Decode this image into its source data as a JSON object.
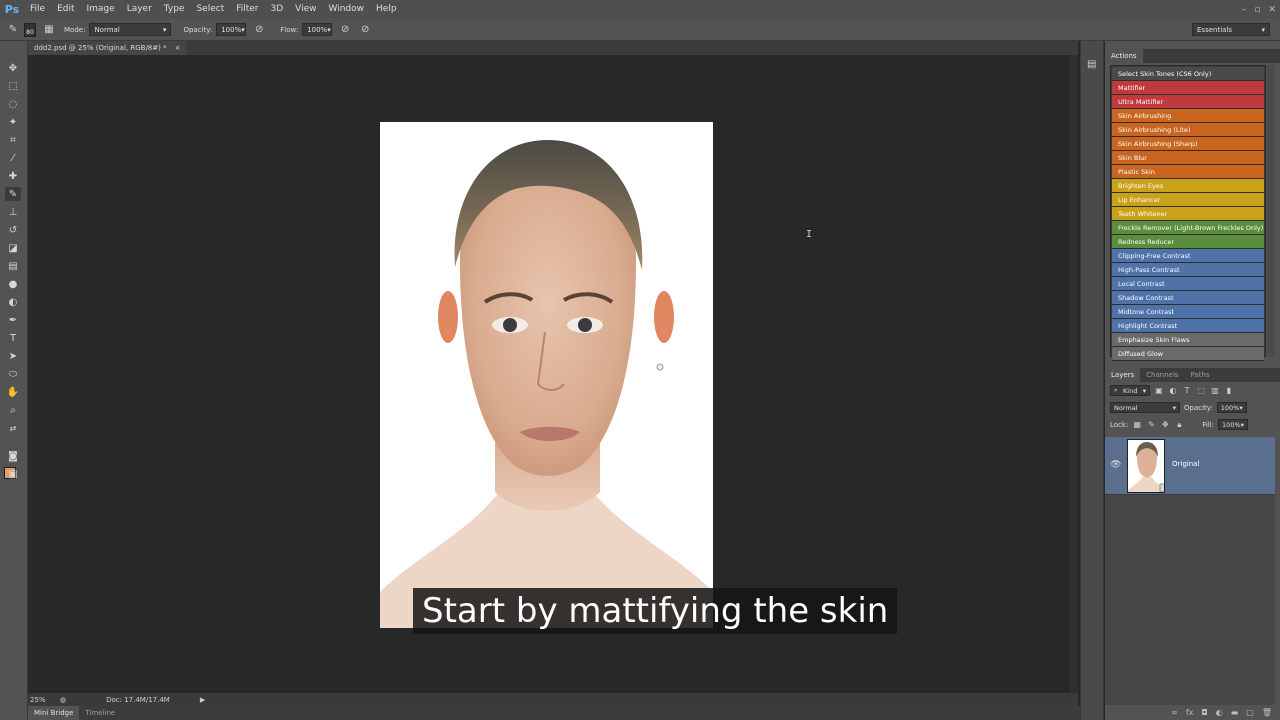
{
  "app": {
    "logo": "Ps"
  },
  "menu": [
    "File",
    "Edit",
    "Image",
    "Layer",
    "Type",
    "Select",
    "Filter",
    "3D",
    "View",
    "Window",
    "Help"
  ],
  "window_controls": [
    "–",
    "▫",
    "✕"
  ],
  "options": {
    "brush_size": "80",
    "mode_label": "Mode:",
    "mode_value": "Normal",
    "opacity_label": "Opacity:",
    "opacity_value": "100%",
    "flow_label": "Flow:",
    "flow_value": "100%",
    "workspace": "Essentials"
  },
  "document": {
    "tab_title": "ddd2.psd @ 25% (Original, RGB/8#) *",
    "tab_close": "×"
  },
  "caption": "Start by mattifying the skin",
  "status": {
    "zoom": "25%",
    "doc_info": "Doc: 17.4M/17.4M"
  },
  "bottom_tabs": [
    "Mini Bridge",
    "Timeline"
  ],
  "actions_panel": {
    "tab": "Actions",
    "items": [
      {
        "label": "Select Skin Tones (CS6 Only)",
        "color": "#4a4a4a"
      },
      {
        "label": "Mattifier",
        "color": "#c0393d"
      },
      {
        "label": "Ultra Mattifier",
        "color": "#c0393d"
      },
      {
        "label": "Skin Airbrushing",
        "color": "#c9651e"
      },
      {
        "label": "Skin Airbrushing (Lite)",
        "color": "#c9651e"
      },
      {
        "label": "Skin Airbrushing (Sharp)",
        "color": "#c9651e"
      },
      {
        "label": "Skin Blur",
        "color": "#c9651e"
      },
      {
        "label": "Plastic Skin",
        "color": "#c9651e"
      },
      {
        "label": "Brighten Eyes",
        "color": "#c9a11a"
      },
      {
        "label": "Lip Enhancer",
        "color": "#c9a11a"
      },
      {
        "label": "Teeth Whitener",
        "color": "#c9a11a"
      },
      {
        "label": "Freckle Remover (Light-Brown Freckles Only)",
        "color": "#5b8e3c"
      },
      {
        "label": "Redness Reducer",
        "color": "#5b8e3c"
      },
      {
        "label": "Clipping-Free Contrast",
        "color": "#4f72a8"
      },
      {
        "label": "High-Pass Contrast",
        "color": "#4f72a8"
      },
      {
        "label": "Local Contrast",
        "color": "#4f72a8"
      },
      {
        "label": "Shadow Contrast",
        "color": "#4f72a8"
      },
      {
        "label": "Midtone Contrast",
        "color": "#4f72a8"
      },
      {
        "label": "Highlight Contrast",
        "color": "#4f72a8"
      },
      {
        "label": "Emphasize Skin Flaws",
        "color": "#6a6a6a"
      },
      {
        "label": "Diffused Glow",
        "color": "#6a6a6a"
      }
    ]
  },
  "layers_panel": {
    "tabs": [
      "Layers",
      "Channels",
      "Paths"
    ],
    "kind_label": "Kind",
    "blend_mode": "Normal",
    "opacity_label": "Opacity:",
    "opacity_value": "100%",
    "lock_label": "Lock:",
    "fill_label": "Fill:",
    "fill_value": "100%",
    "layers": [
      {
        "name": "Original"
      }
    ]
  }
}
